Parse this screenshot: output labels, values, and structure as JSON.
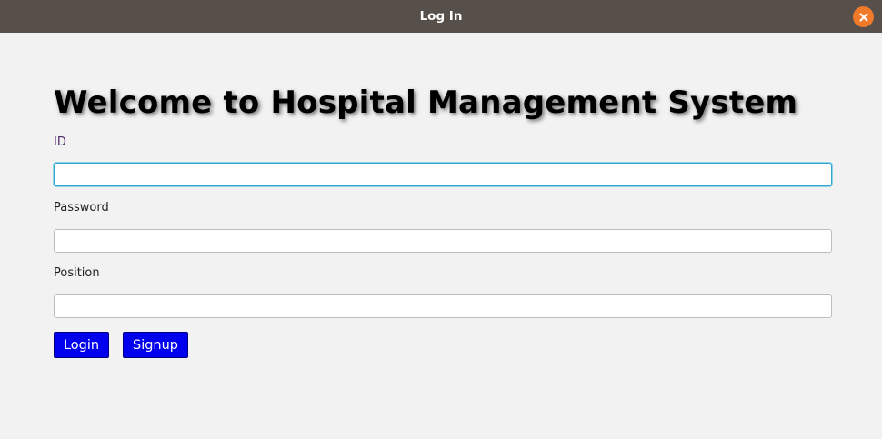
{
  "window": {
    "title": "Log In",
    "close_icon": "close-icon"
  },
  "form": {
    "heading": "Welcome to Hospital Management System",
    "fields": {
      "id": {
        "label": "ID",
        "value": "",
        "placeholder": ""
      },
      "password": {
        "label": "Password",
        "value": "",
        "placeholder": ""
      },
      "position": {
        "label": "Position",
        "value": "",
        "placeholder": ""
      }
    },
    "buttons": {
      "login": "Login",
      "signup": "Signup"
    }
  },
  "colors": {
    "titlebar": "#574f4a",
    "close_button": "#f07a2a",
    "background": "#f3f2f2",
    "button": "#0000ee",
    "focus_border": "#2fa6cf"
  }
}
